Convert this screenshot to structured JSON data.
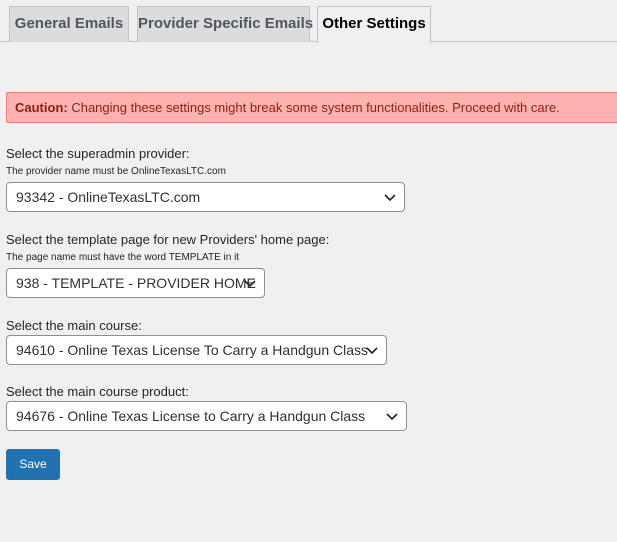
{
  "tabs": [
    {
      "label": "General Emails",
      "active": false
    },
    {
      "label": "Provider Specific Emails",
      "active": false
    },
    {
      "label": "Other Settings",
      "active": true
    }
  ],
  "caution": {
    "strong": "Caution:",
    "text": " Changing these settings might break some system functionalities. Proceed with care."
  },
  "fields": {
    "superadmin": {
      "label": "Select the superadmin provider:",
      "hint": "The provider name must be OnlineTexasLTC.com",
      "value": "93342 - OnlineTexasLTC.com"
    },
    "template": {
      "label": "Select the template page for new Providers' home page:",
      "hint": "The page name must have the word TEMPLATE in it",
      "value": "938 - TEMPLATE - PROVIDER HOME"
    },
    "course": {
      "label": "Select the main course:",
      "value": "94610 - Online Texas License To Carry a Handgun Class"
    },
    "product": {
      "label": "Select the main course product:",
      "value": "94676 - Online Texas License to Carry a Handgun Class"
    }
  },
  "save_label": "Save",
  "colors": {
    "accent": "#2271b1",
    "caution_bg": "#ffb3b1",
    "caution_text": "#8a1f11"
  }
}
